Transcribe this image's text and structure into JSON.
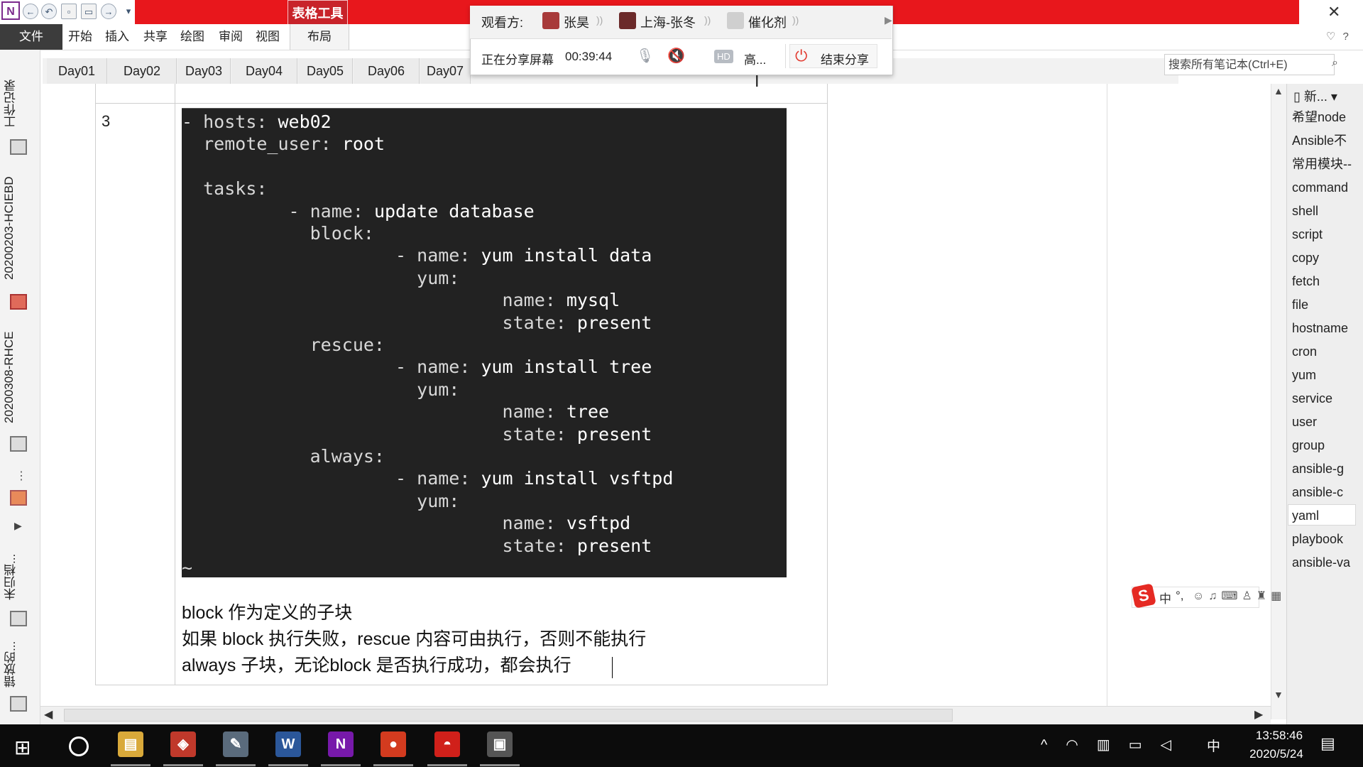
{
  "app": {
    "icon_letter": "N",
    "contextual_tab": "表格工具",
    "file_tab": "文件",
    "menu": [
      "开始",
      "插入",
      "共享",
      "绘图",
      "审阅",
      "视图"
    ],
    "layout_tab": "布局",
    "close_symbol": "✕"
  },
  "section_tabs": [
    "Day01",
    "Day02",
    "Day03",
    "Day04",
    "Day05",
    "Day06",
    "Day07"
  ],
  "search": {
    "placeholder": "搜索所有笔记本(Ctrl+E)"
  },
  "left_sidebar": {
    "notebooks": [
      "工作记录",
      "20200203-HCIEBD",
      "20200308-RHCE",
      "未归档...",
      "错放的..."
    ]
  },
  "share_panel": {
    "viewers_label": "观看方:",
    "viewers": [
      {
        "name": "张昊",
        "color": "#a83a3a"
      },
      {
        "name": "上海-张冬",
        "color": "#6b2a2a"
      },
      {
        "name": "催化剂",
        "color": "#cfcfcf"
      }
    ],
    "status": "正在分享屏幕",
    "elapsed": "00:39:44",
    "hd_label": "HD",
    "quality": "高...",
    "end_button": "结束分享"
  },
  "note": {
    "row_number": "3",
    "code_lines": [
      {
        "indent": "- ",
        "key": "hosts:",
        "val": " web02"
      },
      {
        "indent": "  ",
        "key": "remote_user:",
        "val": " root"
      },
      {
        "indent": "",
        "key": "",
        "val": ""
      },
      {
        "indent": "  ",
        "key": "tasks:",
        "val": ""
      },
      {
        "indent": "          - ",
        "key": "name:",
        "val": " update database"
      },
      {
        "indent": "            ",
        "key": "block:",
        "val": ""
      },
      {
        "indent": "                    - ",
        "key": "name:",
        "val": " yum install data"
      },
      {
        "indent": "                      ",
        "key": "yum:",
        "val": ""
      },
      {
        "indent": "                              ",
        "key": "name:",
        "val": " mysql"
      },
      {
        "indent": "                              ",
        "key": "state:",
        "val": " present"
      },
      {
        "indent": "            ",
        "key": "rescue:",
        "val": ""
      },
      {
        "indent": "                    - ",
        "key": "name:",
        "val": " yum install tree"
      },
      {
        "indent": "                      ",
        "key": "yum:",
        "val": ""
      },
      {
        "indent": "                              ",
        "key": "name:",
        "val": " tree"
      },
      {
        "indent": "                              ",
        "key": "state:",
        "val": " present"
      },
      {
        "indent": "            ",
        "key": "always:",
        "val": ""
      },
      {
        "indent": "                    - ",
        "key": "name:",
        "val": " yum install vsftpd"
      },
      {
        "indent": "                      ",
        "key": "yum:",
        "val": ""
      },
      {
        "indent": "                              ",
        "key": "name:",
        "val": " vsftpd"
      },
      {
        "indent": "                              ",
        "key": "state:",
        "val": " present"
      },
      {
        "indent": "~",
        "key": "",
        "val": ""
      }
    ],
    "text_lines": [
      "block 作为定义的子块",
      "如果 block 执行失败，rescue 内容可由执行，否则不能执行",
      "always 子块，无论block 是否执行成功，都会执行"
    ]
  },
  "page_list": {
    "new_label": "新...",
    "pages": [
      "希望node",
      "Ansible不",
      "常用模块--",
      "command",
      "shell",
      "script",
      "copy",
      "fetch",
      "file",
      "hostname",
      "cron",
      "yum",
      "service",
      "user",
      "group",
      "ansible-g",
      "ansible-c",
      "yaml",
      "playbook",
      "ansible-va"
    ],
    "selected": "yaml"
  },
  "ime": {
    "logo": "S",
    "lang": "中",
    "punct": "°,"
  },
  "taskbar": {
    "apps": [
      {
        "name": "file-explorer",
        "label": "▤",
        "color": "#d9a93a"
      },
      {
        "name": "remote-app",
        "label": "◈",
        "color": "#c0392b"
      },
      {
        "name": "screenshot-app",
        "label": "✎",
        "color": "#5a6b7c"
      },
      {
        "name": "word",
        "label": "W",
        "color": "#2b579a"
      },
      {
        "name": "onenote",
        "label": "N",
        "color": "#7719aa"
      },
      {
        "name": "browser",
        "label": "●",
        "color": "#d33b1f"
      },
      {
        "name": "qq",
        "label": "◓",
        "color": "#d0201a"
      },
      {
        "name": "recorder",
        "label": "▣",
        "color": "#555555"
      }
    ],
    "tray_lang": "中",
    "time": "13:58:46",
    "date": "2020/5/24"
  }
}
